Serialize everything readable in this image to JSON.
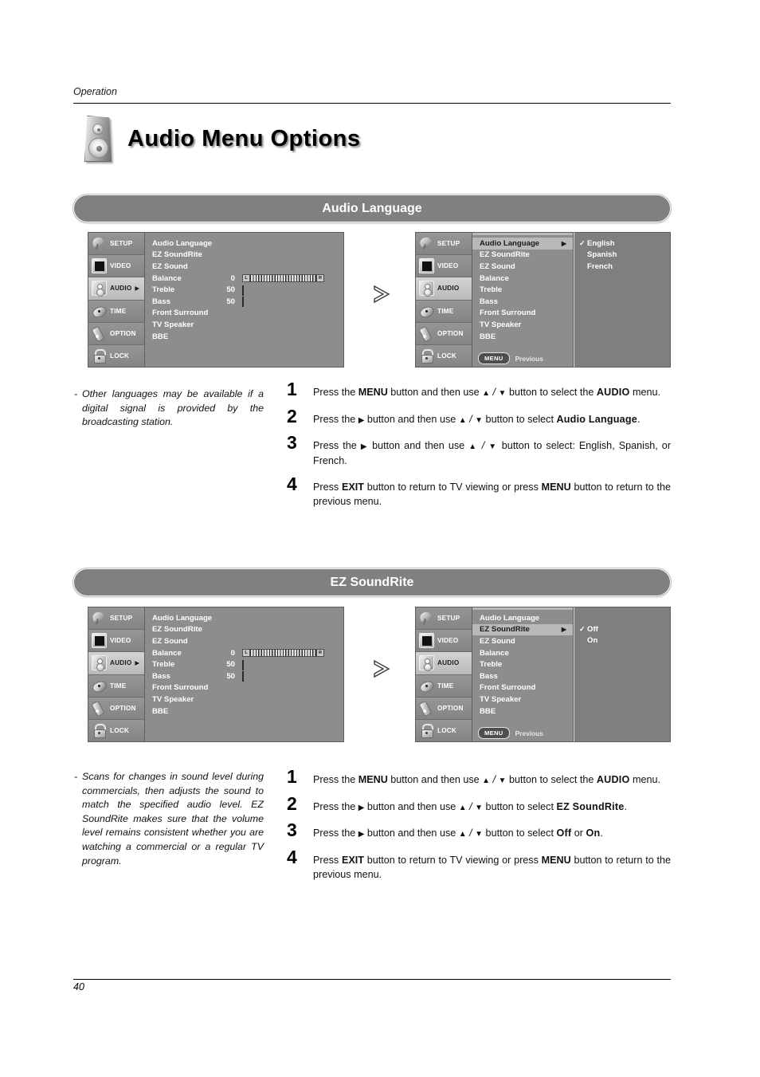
{
  "document": {
    "running_head": "Operation",
    "title": "Audio Menu Options",
    "page_number": "40"
  },
  "osd_sidebar": [
    {
      "label": "SETUP",
      "icon": "satellite-dish-icon",
      "active": false,
      "arrow": ""
    },
    {
      "label": "VIDEO",
      "icon": "tv-screen-icon",
      "active": false,
      "arrow": ""
    },
    {
      "label": "AUDIO",
      "icon": "speaker-icon",
      "active": true,
      "arrow": "▶"
    },
    {
      "label": "TIME",
      "icon": "clock-icon",
      "active": false,
      "arrow": ""
    },
    {
      "label": "OPTION",
      "icon": "remote-control-icon",
      "active": false,
      "arrow": ""
    },
    {
      "label": "LOCK",
      "icon": "padlock-icon",
      "active": false,
      "arrow": ""
    }
  ],
  "osd_sidebar_no_arrow": [
    {
      "label": "SETUP",
      "icon": "satellite-dish-icon",
      "active": false,
      "arrow": ""
    },
    {
      "label": "VIDEO",
      "icon": "tv-screen-icon",
      "active": false,
      "arrow": ""
    },
    {
      "label": "AUDIO",
      "icon": "speaker-icon",
      "active": true,
      "arrow": ""
    },
    {
      "label": "TIME",
      "icon": "clock-icon",
      "active": false,
      "arrow": ""
    },
    {
      "label": "OPTION",
      "icon": "remote-control-icon",
      "active": false,
      "arrow": ""
    },
    {
      "label": "LOCK",
      "icon": "padlock-icon",
      "active": false,
      "arrow": ""
    }
  ],
  "audio_menu_items": [
    {
      "label": "Audio Language",
      "value": ""
    },
    {
      "label": "EZ SoundRite",
      "value": ""
    },
    {
      "label": "EZ Sound",
      "value": ""
    },
    {
      "label": "Balance",
      "value": "0"
    },
    {
      "label": "Treble",
      "value": "50"
    },
    {
      "label": "Bass",
      "value": "50"
    },
    {
      "label": "Front Surround",
      "value": ""
    },
    {
      "label": "TV Speaker",
      "value": ""
    },
    {
      "label": "BBE",
      "value": ""
    }
  ],
  "slider_values": {
    "balance": 0,
    "balance_left_cap": "L",
    "balance_right_cap": "R",
    "treble": 50,
    "bass": 50,
    "fill_percent": 59
  },
  "osd_footer": {
    "menu_button": "MENU",
    "previous_label": "Previous"
  },
  "section1": {
    "header": "Audio Language",
    "submenu_parent": "Audio Language",
    "submenu_arrow": "▶",
    "submenu_items": [
      {
        "label": "English",
        "checked": true,
        "check": "✓"
      },
      {
        "label": "Spanish",
        "checked": false,
        "check": ""
      },
      {
        "label": "French",
        "checked": false,
        "check": ""
      }
    ],
    "note": "Other languages may be available if a digital signal is provided by the broadcasting station.",
    "note_dash": "-",
    "steps": [
      {
        "num": "1",
        "text_html": "Press the <b>MENU</b> button and then use <span class=\"ar\">▲</span> <i>/</i> <span class=\"ar\">▼</span> button to select the <span class=\"hv\">AUDIO</span> menu."
      },
      {
        "num": "2",
        "text_html": "Press the <span class=\"ar\">▶</span> button and then use <span class=\"ar\">▲</span> <i>/</i> <span class=\"ar\">▼</span> button to select <span class=\"hv\">Audio Language</span>."
      },
      {
        "num": "3",
        "text_html": "Press the <span class=\"ar\">▶</span> button and then use <span class=\"ar\">▲</span> <i>/</i> <span class=\"ar\">▼</span> button to select: English, Spanish, or French."
      },
      {
        "num": "4",
        "text_html": "Press <b>EXIT</b> button to return to TV viewing or press <b>MENU</b> button to return to the previous menu."
      }
    ]
  },
  "section2": {
    "header": "EZ SoundRite",
    "submenu_parent": "EZ SoundRite",
    "submenu_arrow": "▶",
    "submenu_items": [
      {
        "label": "Off",
        "checked": true,
        "check": "✓"
      },
      {
        "label": "On",
        "checked": false,
        "check": ""
      }
    ],
    "note": "Scans for changes in sound level during commercials, then adjusts the sound to match the specified audio level. EZ SoundRite makes sure that the volume level remains consistent whether you are watching a commercial or a regular TV program.",
    "note_dash": "-",
    "steps": [
      {
        "num": "1",
        "text_html": "Press the <b>MENU</b> button and then use <span class=\"ar\">▲</span> <i>/</i> <span class=\"ar\">▼</span> button to select the <span class=\"hv\">AUDIO</span> menu."
      },
      {
        "num": "2",
        "text_html": "Press the <span class=\"ar\">▶</span> button and then use <span class=\"ar\">▲</span> <i>/</i> <span class=\"ar\">▼</span> button to select <span class=\"hv\">EZ SoundRite</span>."
      },
      {
        "num": "3",
        "text_html": "Press the <span class=\"ar\">▶</span> button and then use <span class=\"ar\">▲</span> <i>/</i> <span class=\"ar\">▼</span> button to select <span class=\"hv\">Off</span> or <span class=\"hv\">On</span>."
      },
      {
        "num": "4",
        "text_html": "Press <b>EXIT</b> button to return to TV viewing or press <b>MENU</b> button to return to the previous menu."
      }
    ]
  },
  "colors": {
    "osd_background": "#8d8d8d",
    "osd_submenu_background": "#7f7f7f",
    "osd_highlight": "#b9b9b9",
    "section_bar": "#808080",
    "text_light": "#ffffff"
  }
}
